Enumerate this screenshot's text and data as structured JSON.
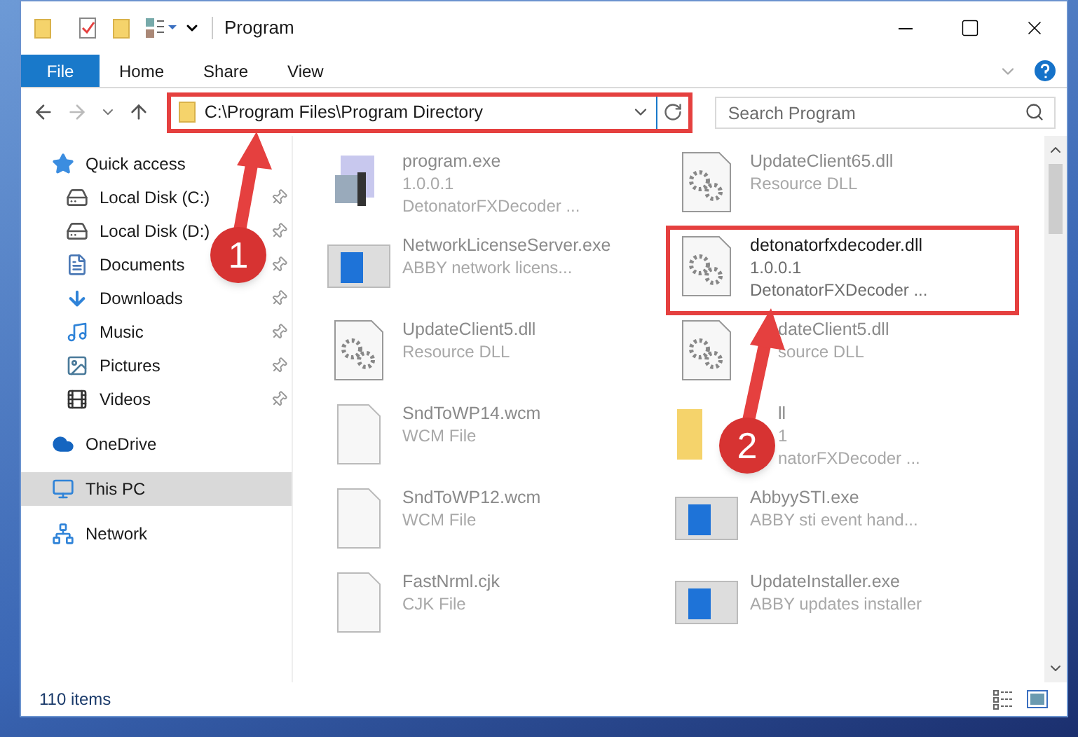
{
  "title_bar": {
    "title": "Program"
  },
  "ribbon_tabs": [
    {
      "label": "File",
      "kind": "file"
    },
    {
      "label": "Home",
      "kind": "tab"
    },
    {
      "label": "Share",
      "kind": "tab"
    },
    {
      "label": "View",
      "kind": "tab"
    }
  ],
  "address": {
    "path": "C:\\Program Files\\Program Directory",
    "highlighted": true
  },
  "search": {
    "placeholder": "Search Program"
  },
  "sidebar": {
    "items": [
      {
        "label": "Quick access",
        "kind": "star",
        "selected": false,
        "children": [
          {
            "label": "Local Disk (C:)",
            "kind": "drive",
            "pinned": true,
            "selected": false
          },
          {
            "label": "Local Disk (D:)",
            "kind": "drive",
            "pinned": true,
            "selected": false
          },
          {
            "label": "Documents",
            "kind": "document",
            "pinned": true,
            "selected": false
          },
          {
            "label": "Downloads",
            "kind": "download",
            "pinned": true,
            "selected": false
          },
          {
            "label": "Music",
            "kind": "music",
            "pinned": true,
            "selected": false
          },
          {
            "label": "Pictures",
            "kind": "pictures",
            "pinned": true,
            "selected": false
          },
          {
            "label": "Videos",
            "kind": "videos",
            "pinned": true,
            "selected": false
          }
        ]
      },
      {
        "label": "OneDrive",
        "kind": "cloud",
        "selected": false
      },
      {
        "label": "This PC",
        "kind": "pc",
        "selected": true
      },
      {
        "label": "Network",
        "kind": "network",
        "selected": false
      }
    ]
  },
  "files": [
    {
      "name": "program.exe",
      "lines": [
        "1.0.0.1",
        "DetonatorFXDecoder ..."
      ],
      "kind": "exe",
      "faded": true,
      "highlighted": false,
      "covered": false
    },
    {
      "name": "UpdateClient65.dll",
      "lines": [
        "Resource DLL"
      ],
      "kind": "dll",
      "faded": true,
      "highlighted": false,
      "covered": false
    },
    {
      "name": "NetworkLicenseServer.exe",
      "lines": [
        "ABBY network licens..."
      ],
      "kind": "app",
      "faded": true,
      "highlighted": false,
      "covered": false
    },
    {
      "name": "detonatorfxdecoder.dll",
      "lines": [
        "1.0.0.1",
        "DetonatorFXDecoder ..."
      ],
      "kind": "dll",
      "faded": false,
      "highlighted": true,
      "covered": false
    },
    {
      "name": "UpdateClient5.dll",
      "lines": [
        "Resource DLL"
      ],
      "kind": "dll",
      "faded": true,
      "highlighted": false,
      "covered": false
    },
    {
      "name": "dateClient5.dll",
      "lines": [
        "source DLL"
      ],
      "kind": "dll",
      "faded": true,
      "highlighted": false,
      "covered": true
    },
    {
      "name": "SndToWP14.wcm",
      "lines": [
        "WCM File"
      ],
      "kind": "blank",
      "faded": true,
      "highlighted": false,
      "covered": false
    },
    {
      "name": "ll",
      "lines": [
        "1",
        "natorFXDecoder ..."
      ],
      "kind": "folder",
      "faded": true,
      "highlighted": false,
      "covered": true
    },
    {
      "name": "SndToWP12.wcm",
      "lines": [
        "WCM File"
      ],
      "kind": "blank",
      "faded": true,
      "highlighted": false,
      "covered": false
    },
    {
      "name": "AbbyySTI.exe",
      "lines": [
        "ABBY sti event hand..."
      ],
      "kind": "app",
      "faded": true,
      "highlighted": false,
      "covered": false
    },
    {
      "name": "FastNrml.cjk",
      "lines": [
        "CJK File"
      ],
      "kind": "blank",
      "faded": true,
      "highlighted": false,
      "covered": false
    },
    {
      "name": "UpdateInstaller.exe",
      "lines": [
        "ABBY updates installer"
      ],
      "kind": "app",
      "faded": true,
      "highlighted": false,
      "covered": false
    }
  ],
  "status_bar": {
    "item_count": "110 items"
  },
  "annotations": [
    {
      "label": "1"
    },
    {
      "label": "2"
    }
  ]
}
